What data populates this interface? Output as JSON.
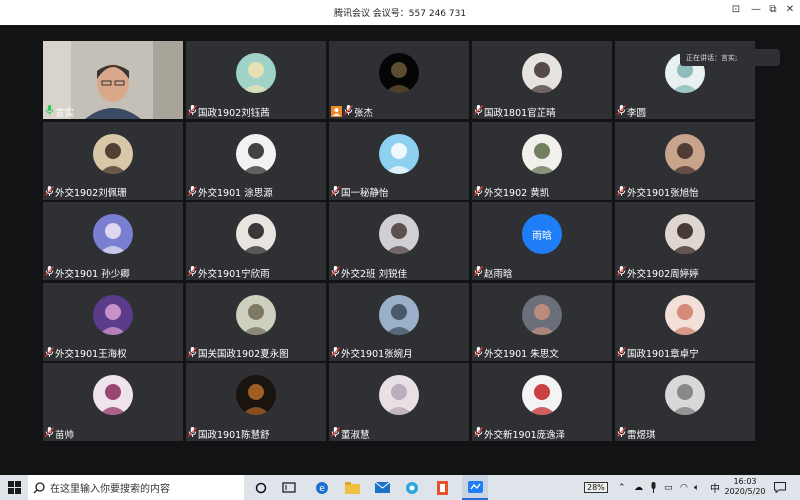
{
  "window": {
    "title": "腾讯会议 会议号：557 246 731"
  },
  "speaker": {
    "label": "正在讲话：言实;"
  },
  "participants": [
    {
      "name": "言实",
      "mic": "on",
      "kind": "video"
    },
    {
      "name": "国政1902刘钰茜",
      "kind": "avatar",
      "c1": "#9fd3c7",
      "c2": "#f2e2b0"
    },
    {
      "name": "张杰",
      "kind": "avatar",
      "badge": true,
      "c1": "#050505",
      "c2": "#6b5a3a"
    },
    {
      "name": "国政1801官芷晴",
      "kind": "avatar",
      "c1": "#e6e2de",
      "c2": "#3b2f2f"
    },
    {
      "name": "李圆",
      "kind": "avatar",
      "c1": "#e8f0f0",
      "c2": "#7fb3b0"
    },
    {
      "name": "外交1902刘佩珊",
      "kind": "avatar",
      "c1": "#d9c8a8",
      "c2": "#3a2a20"
    },
    {
      "name": "外交1901 涂思源",
      "kind": "avatar",
      "c1": "#f2f2f2",
      "c2": "#222222"
    },
    {
      "name": "国一秘静怡",
      "kind": "avatar",
      "c1": "#8ed0f0",
      "c2": "#ffffff"
    },
    {
      "name": "外交1902 黄凯",
      "kind": "avatar",
      "c1": "#f1f0ea",
      "c2": "#5e6b4a"
    },
    {
      "name": "外交1901张旭怡",
      "kind": "avatar",
      "c1": "#c9a48c",
      "c2": "#3b2a26"
    },
    {
      "name": "外交1901 孙少卿",
      "kind": "avatar",
      "c1": "#7a7fd1",
      "c2": "#f0e6f5"
    },
    {
      "name": "外交1901宁欣雨",
      "kind": "avatar",
      "c1": "#e8e4e0",
      "c2": "#1b1b1b"
    },
    {
      "name": "外交2班 刘锐佳",
      "kind": "avatar",
      "c1": "#d0d0d4",
      "c2": "#4a3a3a"
    },
    {
      "name": "赵雨晗",
      "kind": "text",
      "text": "雨晗"
    },
    {
      "name": "外交1902周婷婷",
      "kind": "avatar",
      "c1": "#e0d6d0",
      "c2": "#2d1f1b"
    },
    {
      "name": "外交1901王海权",
      "kind": "avatar",
      "c1": "#5a3c8a",
      "c2": "#d8a0d0"
    },
    {
      "name": "国关国政1902夏永图",
      "kind": "avatar",
      "c1": "#cfcfbf",
      "c2": "#6e6a55"
    },
    {
      "name": "外交1901张婉月",
      "kind": "avatar",
      "c1": "#9ab0c8",
      "c2": "#3a4a5a"
    },
    {
      "name": "外交1901 朱思文",
      "kind": "avatar",
      "c1": "#6a6f7a",
      "c2": "#c99080"
    },
    {
      "name": "国政1901章卓宁",
      "kind": "avatar",
      "c1": "#f2e0d8",
      "c2": "#d07a6a"
    },
    {
      "name": "苗帅",
      "kind": "avatar",
      "c1": "#f0e4ec",
      "c2": "#8a2a5a"
    },
    {
      "name": "国政1901陈慧舒",
      "kind": "avatar",
      "c1": "#1a1410",
      "c2": "#b86a2a"
    },
    {
      "name": "董淑慧",
      "kind": "avatar",
      "c1": "#e8e0e4",
      "c2": "#b0a4b4"
    },
    {
      "name": "外交新1901庞逸泽",
      "kind": "avatar",
      "c1": "#f4f4f4",
      "c2": "#c02020"
    },
    {
      "name": "雷煜琪",
      "kind": "avatar",
      "c1": "#d8d8d8",
      "c2": "#7a7a7a"
    }
  ],
  "taskbar": {
    "search_placeholder": "在这里输入你要搜索的内容",
    "battery": "28%",
    "ime": "中",
    "time": "16:03",
    "date": "2020/5/20"
  }
}
